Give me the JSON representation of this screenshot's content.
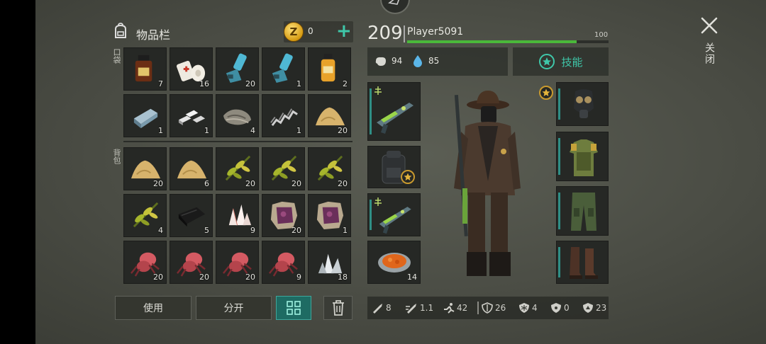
{
  "inventory": {
    "title": "物品栏",
    "coins": "0",
    "plus": "+",
    "pockets_label": "口袋",
    "backpack_label": "背包",
    "pockets": [
      {
        "icon": "iodine-bottle-icon",
        "count": "7"
      },
      {
        "icon": "bandage-icon",
        "count": "16"
      },
      {
        "icon": "inhaler-icon",
        "count": "20"
      },
      {
        "icon": "inhaler-icon",
        "count": "1"
      },
      {
        "icon": "orange-vial-icon",
        "count": "2"
      },
      {
        "icon": "iron-ingot-icon",
        "count": "1"
      },
      {
        "icon": "aluminum-ingots-icon",
        "count": "1"
      },
      {
        "icon": "cloth-icon",
        "count": "4"
      },
      {
        "icon": "spring-icon",
        "count": "1"
      },
      {
        "icon": "sand-pile-icon",
        "count": "20"
      }
    ],
    "backpack": [
      {
        "icon": "sand-pile-icon",
        "count": "20"
      },
      {
        "icon": "sand-pile-icon",
        "count": "6"
      },
      {
        "icon": "herb-icon",
        "count": "20"
      },
      {
        "icon": "herb-icon",
        "count": "20"
      },
      {
        "icon": "herb-icon",
        "count": "20"
      },
      {
        "icon": "herb-icon",
        "count": "4"
      },
      {
        "icon": "black-leather-icon",
        "count": "5"
      },
      {
        "icon": "crystal-icon",
        "count": "9"
      },
      {
        "icon": "animal-hide-icon",
        "count": "20"
      },
      {
        "icon": "animal-hide-icon",
        "count": "1"
      },
      {
        "icon": "spider-gland-icon",
        "count": "20"
      },
      {
        "icon": "spider-gland-icon",
        "count": "20"
      },
      {
        "icon": "spider-gland-icon",
        "count": "20"
      },
      {
        "icon": "spider-gland-icon",
        "count": "9"
      },
      {
        "icon": "quartz-icon",
        "count": "18"
      }
    ],
    "use_label": "使用",
    "split_label": "分开"
  },
  "player": {
    "level": "209",
    "name": "Player5091",
    "xp_max": "100",
    "xp_fraction": 0.84,
    "hunger": "94",
    "thirst": "85",
    "skills_label": "技能"
  },
  "equipment": {
    "left": [
      {
        "icon": "plasma-rifle-icon",
        "count": ""
      },
      {
        "icon": "backpack-icon",
        "count": ""
      },
      {
        "icon": "plasma-rifle-icon",
        "count": ""
      },
      {
        "icon": "food-plate-icon",
        "count": "14"
      }
    ],
    "right": [
      {
        "icon": "gas-mask-icon"
      },
      {
        "icon": "armor-vest-icon"
      },
      {
        "icon": "pants-icon"
      },
      {
        "icon": "boots-icon"
      }
    ]
  },
  "combat_stats": [
    {
      "icon": "melee-damage-icon",
      "value": "8"
    },
    {
      "icon": "attack-speed-icon",
      "value": "1.1"
    },
    {
      "icon": "movement-icon",
      "value": "42"
    },
    {
      "icon": "armor-icon",
      "value": "26"
    },
    {
      "icon": "cold-resist-icon",
      "value": "4"
    },
    {
      "icon": "radiation-icon",
      "value": "0"
    },
    {
      "icon": "bio-resist-icon",
      "value": "23"
    }
  ],
  "close_label": "关闭",
  "colors": {
    "accent": "#3fc7a9",
    "xp": "#4ab83a",
    "gold": "#d69b12"
  }
}
